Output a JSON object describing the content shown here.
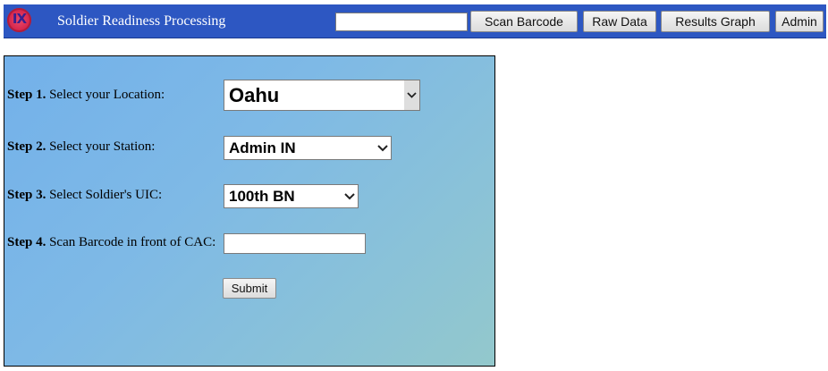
{
  "header": {
    "logo_text": "IX",
    "title": "Soldier Readiness Processing",
    "search_value": "",
    "buttons": {
      "scan_barcode": "Scan Barcode",
      "raw_data": "Raw Data",
      "results_graph": "Results Graph",
      "admin": "Admin"
    }
  },
  "form": {
    "steps": [
      {
        "number": "Step 1.",
        "label": "Select your Location:"
      },
      {
        "number": "Step 2.",
        "label": "Select your Station:"
      },
      {
        "number": "Step 3.",
        "label": "Select Soldier's UIC:"
      },
      {
        "number": "Step 4.",
        "label": "Scan Barcode in front of CAC:"
      }
    ],
    "location": {
      "selected": "Oahu"
    },
    "station": {
      "selected": "Admin IN"
    },
    "uic": {
      "selected": "100th BN"
    },
    "barcode_value": "",
    "submit_label": "Submit"
  },
  "colors": {
    "header_bg": "#2d57c2",
    "panel_gradient_start": "#73b1ea",
    "panel_gradient_end": "#93c8cc",
    "logo_red": "#d7264d"
  },
  "icons": {
    "logo": "ix-logo-icon",
    "dropdown": "chevron-down-icon"
  }
}
